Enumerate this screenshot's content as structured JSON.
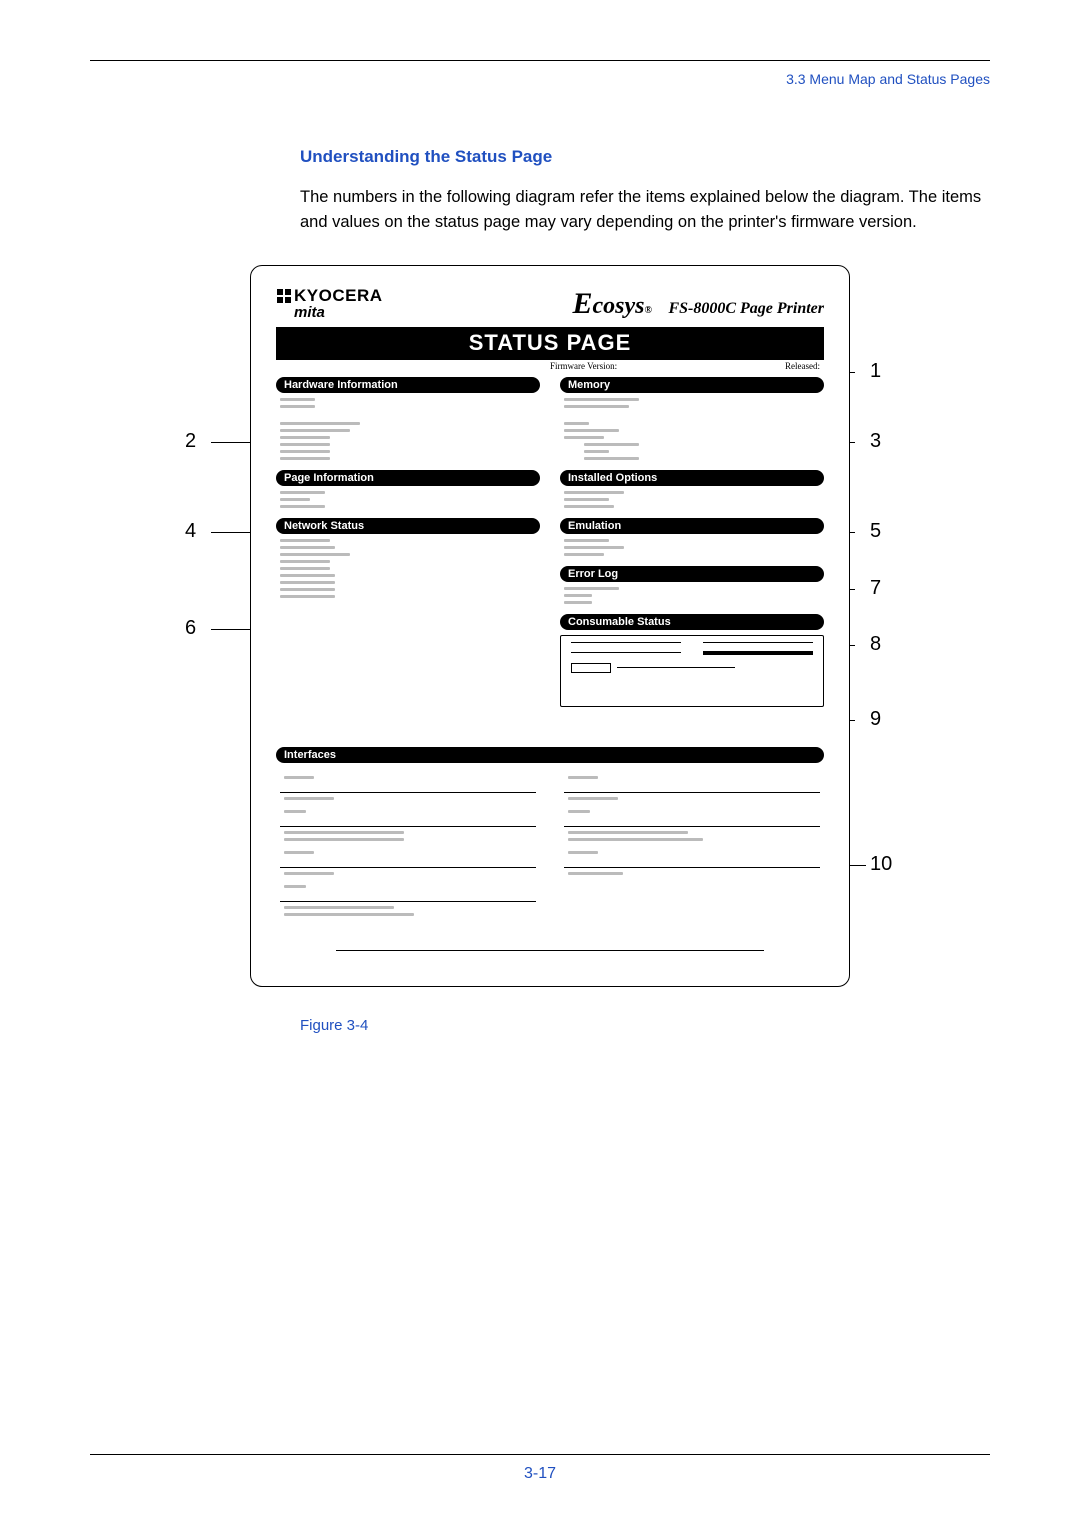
{
  "header": {
    "breadcrumb": "3.3 Menu Map and Status Pages"
  },
  "section": {
    "title": "Understanding the Status Page",
    "body": "The numbers in the following diagram refer the items explained below the diagram. The items and values on the status page may vary depending on the printer's firmware version."
  },
  "statuspage": {
    "brand": "KYOCERA",
    "subbrand": "mita",
    "ecosys": "Ecosys",
    "ecosys_reg": "®",
    "model": "FS-8000C  Page Printer",
    "title_bar": "STATUS PAGE",
    "firmware_label": "Firmware Version:",
    "released_label": "Released:",
    "panels": {
      "hw": "Hardware Information",
      "page": "Page Information",
      "net": "Network Status",
      "mem": "Memory",
      "opts": "Installed Options",
      "emul": "Emulation",
      "err": "Error Log",
      "cons": "Consumable Status",
      "iface": "Interfaces"
    }
  },
  "callouts": {
    "c1": "1",
    "c2": "2",
    "c3": "3",
    "c4": "4",
    "c5": "5",
    "c6": "6",
    "c7": "7",
    "c8": "8",
    "c9": "9",
    "c10": "10"
  },
  "figure_caption": "Figure 3-4",
  "footer": {
    "page_number": "3-17"
  }
}
